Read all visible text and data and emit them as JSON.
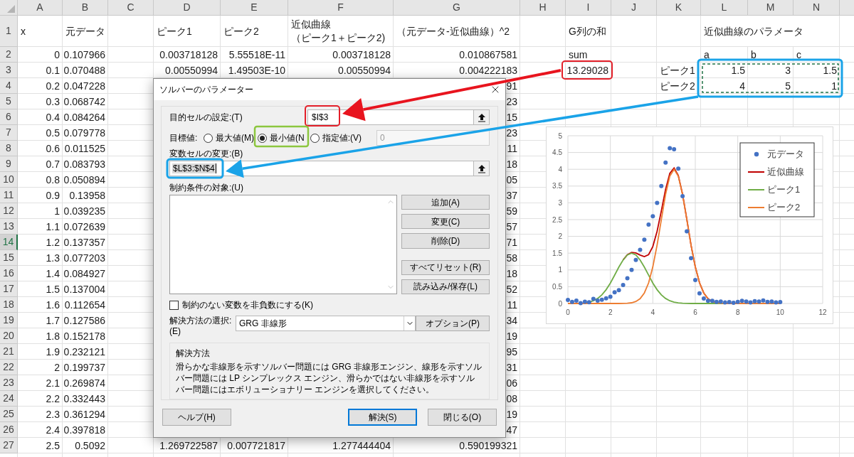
{
  "sheet": {
    "columns": [
      "A",
      "B",
      "C",
      "D",
      "E",
      "F",
      "G",
      "H",
      "I",
      "J",
      "K",
      "L",
      "M",
      "N"
    ],
    "rows": [
      {
        "number": "1",
        "selected": false,
        "a": {
          "kind": "text",
          "text": "x"
        },
        "b": {
          "kind": "text",
          "text": "元データ"
        },
        "d": {
          "kind": "text",
          "text": "ピーク1"
        },
        "e": {
          "kind": "text",
          "text": "ピーク2"
        },
        "f": {
          "kind": "lines",
          "lines": [
            "近似曲線",
            "（ピーク1＋ピーク2)"
          ]
        },
        "g": {
          "kind": "text",
          "text": "（元データ-近似曲線）^2"
        },
        "i": {
          "kind": "text",
          "text": "G列の和"
        },
        "l": {
          "kind": "spill",
          "text": "近似曲線のパラメータ"
        }
      },
      {
        "number": "2",
        "selected": false,
        "a": "0",
        "b": "0.107966",
        "d": "0.003718128",
        "e": "5.55518E-11",
        "f": "0.003718128",
        "g": "0.010867581",
        "i": {
          "kind": "text",
          "text": "sum"
        },
        "l": {
          "kind": "text",
          "text": "a"
        },
        "m": {
          "kind": "text",
          "text": "b"
        },
        "n": {
          "kind": "text",
          "text": "c"
        }
      },
      {
        "number": "3",
        "selected": false,
        "a": "0.1",
        "b": "0.070488",
        "d": "0.00550994",
        "e": "1.49503E-10",
        "f": "0.00550994",
        "g": "0.004222183",
        "i": "13.29028",
        "k": {
          "kind": "text",
          "text": "ピーク1"
        },
        "l": "1.5",
        "m": "3",
        "n": "1.5"
      },
      {
        "number": "4",
        "selected": false,
        "a": "0.2",
        "b": "0.047228",
        "g": "91",
        "k": {
          "kind": "text",
          "text": "ピーク2"
        },
        "l": "4",
        "m": "5",
        "n": "1"
      },
      {
        "number": "5",
        "selected": false,
        "a": "0.3",
        "b": "0.068742",
        "g": "23"
      },
      {
        "number": "6",
        "selected": false,
        "a": "0.4",
        "b": "0.084264",
        "g": "15"
      },
      {
        "number": "7",
        "selected": false,
        "a": "0.5",
        "b": "0.079778",
        "g": "23"
      },
      {
        "number": "8",
        "selected": false,
        "a": "0.6",
        "b": "0.011525",
        "g": "11"
      },
      {
        "number": "9",
        "selected": false,
        "a": "0.7",
        "b": "0.083793",
        "g": "18"
      },
      {
        "number": "10",
        "selected": false,
        "a": "0.8",
        "b": "0.050894",
        "g": "05"
      },
      {
        "number": "11",
        "selected": false,
        "a": "0.9",
        "b": "0.13958",
        "g": "37"
      },
      {
        "number": "12",
        "selected": false,
        "a": "1",
        "b": "0.039235",
        "g": "59"
      },
      {
        "number": "13",
        "selected": false,
        "a": "1.1",
        "b": "0.072639",
        "g": "57"
      },
      {
        "number": "14",
        "selected": true,
        "a": "1.2",
        "b": "0.137357",
        "g": "71"
      },
      {
        "number": "15",
        "selected": false,
        "a": "1.3",
        "b": "0.077203",
        "g": "58"
      },
      {
        "number": "16",
        "selected": false,
        "a": "1.4",
        "b": "0.084927",
        "g": "18"
      },
      {
        "number": "17",
        "selected": false,
        "a": "1.5",
        "b": "0.137004",
        "g": "52"
      },
      {
        "number": "18",
        "selected": false,
        "a": "1.6",
        "b": "0.112654",
        "g": "11"
      },
      {
        "number": "19",
        "selected": false,
        "a": "1.7",
        "b": "0.127586",
        "g": "34"
      },
      {
        "number": "20",
        "selected": false,
        "a": "1.8",
        "b": "0.152178",
        "g": "19"
      },
      {
        "number": "21",
        "selected": false,
        "a": "1.9",
        "b": "0.232121",
        "g": "95"
      },
      {
        "number": "22",
        "selected": false,
        "a": "2",
        "b": "0.199737",
        "g": "31"
      },
      {
        "number": "23",
        "selected": false,
        "a": "2.1",
        "b": "0.269874",
        "g": "06"
      },
      {
        "number": "24",
        "selected": false,
        "a": "2.2",
        "b": "0.332443",
        "g": "08"
      },
      {
        "number": "25",
        "selected": false,
        "a": "2.3",
        "b": "0.361294",
        "g": "19"
      },
      {
        "number": "26",
        "selected": false,
        "a": "2.4",
        "b": "0.397818",
        "g": "47"
      },
      {
        "number": "27",
        "selected": false,
        "a": "2.5",
        "b": "0.5092",
        "d": "1.269722587",
        "e": "0.007721817",
        "f": "1.277444404",
        "g": "0.590199321"
      }
    ]
  },
  "chart": {
    "chart_data": {
      "type": "line",
      "grid": true,
      "legend": "upper right",
      "xlim": [
        0,
        12
      ],
      "ylim": [
        0,
        5
      ],
      "xticks": [
        0,
        2,
        4,
        6,
        8,
        10,
        12
      ],
      "yticks": [
        0,
        0.5,
        1,
        1.5,
        2,
        2.5,
        3,
        3.5,
        4,
        4.5,
        5
      ],
      "x": [
        0,
        0.2,
        0.4,
        0.6,
        0.8,
        1,
        1.2,
        1.4,
        1.6,
        1.8,
        2,
        2.2,
        2.4,
        2.6,
        2.8,
        3,
        3.2,
        3.4,
        3.6,
        3.8,
        4,
        4.2,
        4.4,
        4.6,
        4.8,
        5,
        5.2,
        5.4,
        5.6,
        5.8,
        6,
        6.2,
        6.4,
        6.6,
        6.8,
        7,
        7.2,
        7.4,
        7.6,
        7.8,
        8,
        8.2,
        8.4,
        8.6,
        8.8,
        9,
        9.2,
        9.4,
        9.6,
        9.8,
        10
      ],
      "series": [
        {
          "name": "元データ",
          "type": "scatter",
          "color": "#4472c4",
          "values": [
            0.108,
            0.047,
            0.084,
            0.012,
            0.051,
            0.039,
            0.137,
            0.085,
            0.113,
            0.152,
            0.2,
            0.332,
            0.398,
            0.55,
            0.75,
            1.0,
            1.3,
            1.6,
            1.9,
            2.35,
            2.6,
            3.0,
            3.5,
            4.2,
            4.63,
            4.6,
            4.02,
            3.2,
            2.15,
            1.35,
            0.7,
            0.3,
            0.15,
            0.08,
            0.08,
            0.05,
            0.06,
            0.03,
            0.04,
            0.02,
            0.05,
            0.08,
            0.06,
            0.03,
            0.07,
            0.06,
            0.09,
            0.05,
            0.06,
            0.03,
            0.04
          ]
        },
        {
          "name": "近似曲線",
          "type": "line",
          "color": "#c00000",
          "values": [
            null,
            null,
            null,
            null,
            null,
            null,
            null,
            null,
            null,
            null,
            null,
            null,
            null,
            1.301,
            1.454,
            1.522,
            1.506,
            1.442,
            1.398,
            1.458,
            1.7,
            2.151,
            2.762,
            3.399,
            3.878,
            4.041,
            3.816,
            3.257,
            2.508,
            1.742,
            1.09,
            0.615,
            0.313,
            0.143,
            0.059,
            0.022,
            0.007,
            0.002,
            0.001,
            0,
            0,
            0,
            0,
            0,
            0,
            0,
            0,
            0,
            0,
            0,
            0
          ]
        },
        {
          "name": "ピーク1",
          "type": "line",
          "color": "#70ad47",
          "values": [
            null,
            null,
            null,
            null,
            0.019,
            0.041,
            0.081,
            0.15,
            0.257,
            0.41,
            0.61,
            0.843,
            1.085,
            1.299,
            1.447,
            1.5,
            1.447,
            1.299,
            1.085,
            0.843,
            0.61,
            0.41,
            0.257,
            0.15,
            0.081,
            0.041,
            0.019,
            0.008,
            0.003,
            0.001,
            0,
            0,
            0,
            0,
            0,
            0,
            0,
            0,
            null,
            null,
            null,
            null,
            null,
            null,
            null,
            null,
            null,
            null,
            null,
            null,
            null
          ]
        },
        {
          "name": "ピーク2",
          "type": "line",
          "color": "#ed7d31",
          "values": [
            0,
            0,
            0,
            0,
            0,
            0,
            0,
            0,
            0,
            0,
            0,
            0,
            0.001,
            0.002,
            0.007,
            0.022,
            0.059,
            0.143,
            0.313,
            0.615,
            1.09,
            1.741,
            2.505,
            3.249,
            3.797,
            4,
            3.797,
            3.249,
            2.505,
            1.741,
            1.09,
            0.615,
            0.313,
            0.143,
            0.059,
            0.022,
            0.007,
            0.002,
            0.001,
            0,
            0,
            0,
            0,
            0,
            0,
            0,
            0,
            0,
            0,
            0,
            0
          ]
        }
      ]
    }
  },
  "dialog": {
    "title": "ソルバーのパラメーター",
    "objective_label": "目的セルの設定:(T)",
    "objective_cell": "$I$3",
    "target_label": "目標値:",
    "targets": [
      {
        "label": "最大値(M)",
        "selected": false
      },
      {
        "label": "最小値(N",
        "selected": true
      },
      {
        "label": "指定値:(V)",
        "selected": false
      }
    ],
    "target_value": "0",
    "variables_label": "変数セルの変更:(B)",
    "variables": "$L$3:$N$4",
    "constraints_label": "制約条件の対象:(U)",
    "edit_buttons": [
      "追加(A)",
      "変更(C)",
      "削除(D)"
    ],
    "file_buttons": [
      "すべてリセット(R)",
      "読み込み/保存(L)"
    ],
    "nonnegative": {
      "label": "制約のない変数を非負数にする(K)",
      "checked": false
    },
    "method_label": "解決方法の選択:\n(E)",
    "method": "GRG 非線形",
    "options_button": "オプション(P)",
    "description": {
      "title": "解決方法",
      "text": "滑らかな非線形を示すソルバー問題には GRG 非線形エンジン、線形を示すソルバー問題には LP シンプレックス エンジン、滑らかではない非線形を示すソルバー問題にはエボリューショナリー エンジンを選択してください。"
    },
    "buttons": [
      {
        "label": "ヘルプ(H)",
        "default": false
      },
      {
        "label": "解決(S)",
        "default": true
      },
      {
        "label": "閉じる(O)",
        "default": false
      }
    ]
  }
}
